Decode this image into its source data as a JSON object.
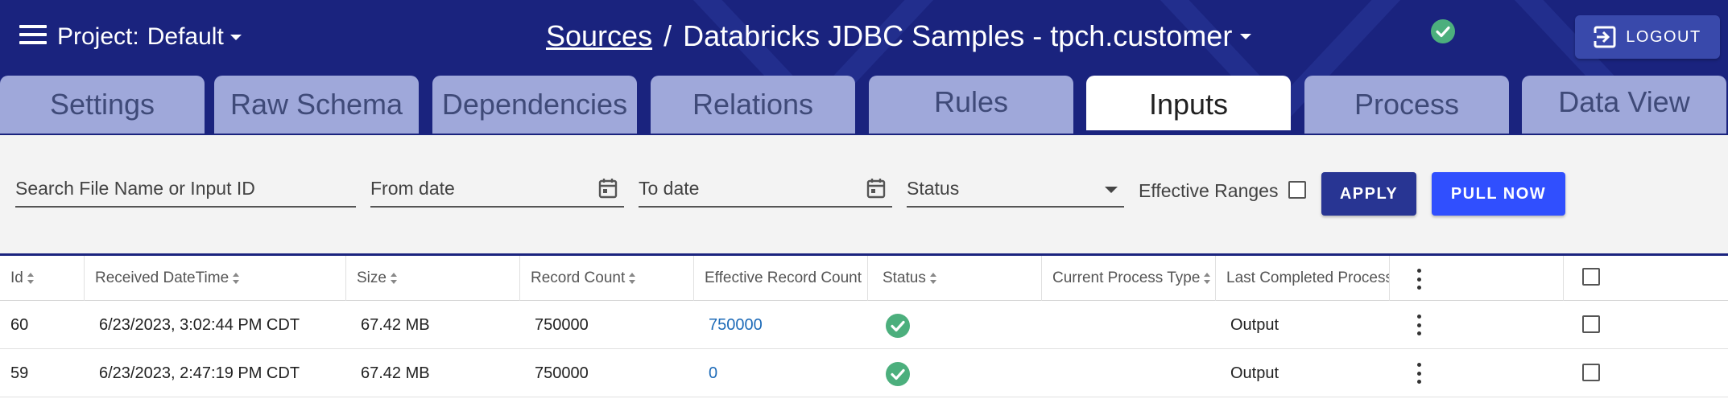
{
  "colors": {
    "header_bg": "#1a237e",
    "tab_bg": "#9fa8da",
    "apply": "#283593",
    "pull_now": "#304ffe",
    "link": "#1e6bb8",
    "success": "#4caf7d"
  },
  "header": {
    "menu_icon": "hamburger-menu-icon",
    "project_label": "Project:",
    "project_value": "Default",
    "breadcrumb_link": "Sources",
    "breadcrumb_sep": "/",
    "source_name": "Databricks JDBC Samples - tpch.customer",
    "status_icon": "check-circle-icon",
    "logout_label": "LOGOUT",
    "logout_icon": "logout-icon"
  },
  "tabs": [
    {
      "label": "Settings"
    },
    {
      "label": "Raw Schema"
    },
    {
      "label": "Dependencies"
    },
    {
      "label": "Relations"
    },
    {
      "label": "Rules"
    },
    {
      "label": "Inputs",
      "active": true
    },
    {
      "label": "Process"
    },
    {
      "label": "Data View"
    }
  ],
  "filters": {
    "search_placeholder": "Search File Name or Input ID",
    "from_placeholder": "From date",
    "to_placeholder": "To date",
    "status_placeholder": "Status",
    "effective_ranges_label": "Effective Ranges",
    "apply_label": "APPLY",
    "pull_now_label": "PULL NOW"
  },
  "table": {
    "columns": [
      "Id",
      "Received DateTime",
      "Size",
      "Record Count",
      "Effective Record Count",
      "Status",
      "Current Process Type",
      "Last Completed Process"
    ],
    "rows": [
      {
        "id": "60",
        "received": "6/23/2023, 3:02:44 PM CDT",
        "size": "67.42 MB",
        "record_count": "750000",
        "effective_count": "750000",
        "status": "success",
        "current_process": "",
        "last_completed": "Output"
      },
      {
        "id": "59",
        "received": "6/23/2023, 2:47:19 PM CDT",
        "size": "67.42 MB",
        "record_count": "750000",
        "effective_count": "0",
        "status": "success",
        "current_process": "",
        "last_completed": "Output"
      }
    ]
  }
}
